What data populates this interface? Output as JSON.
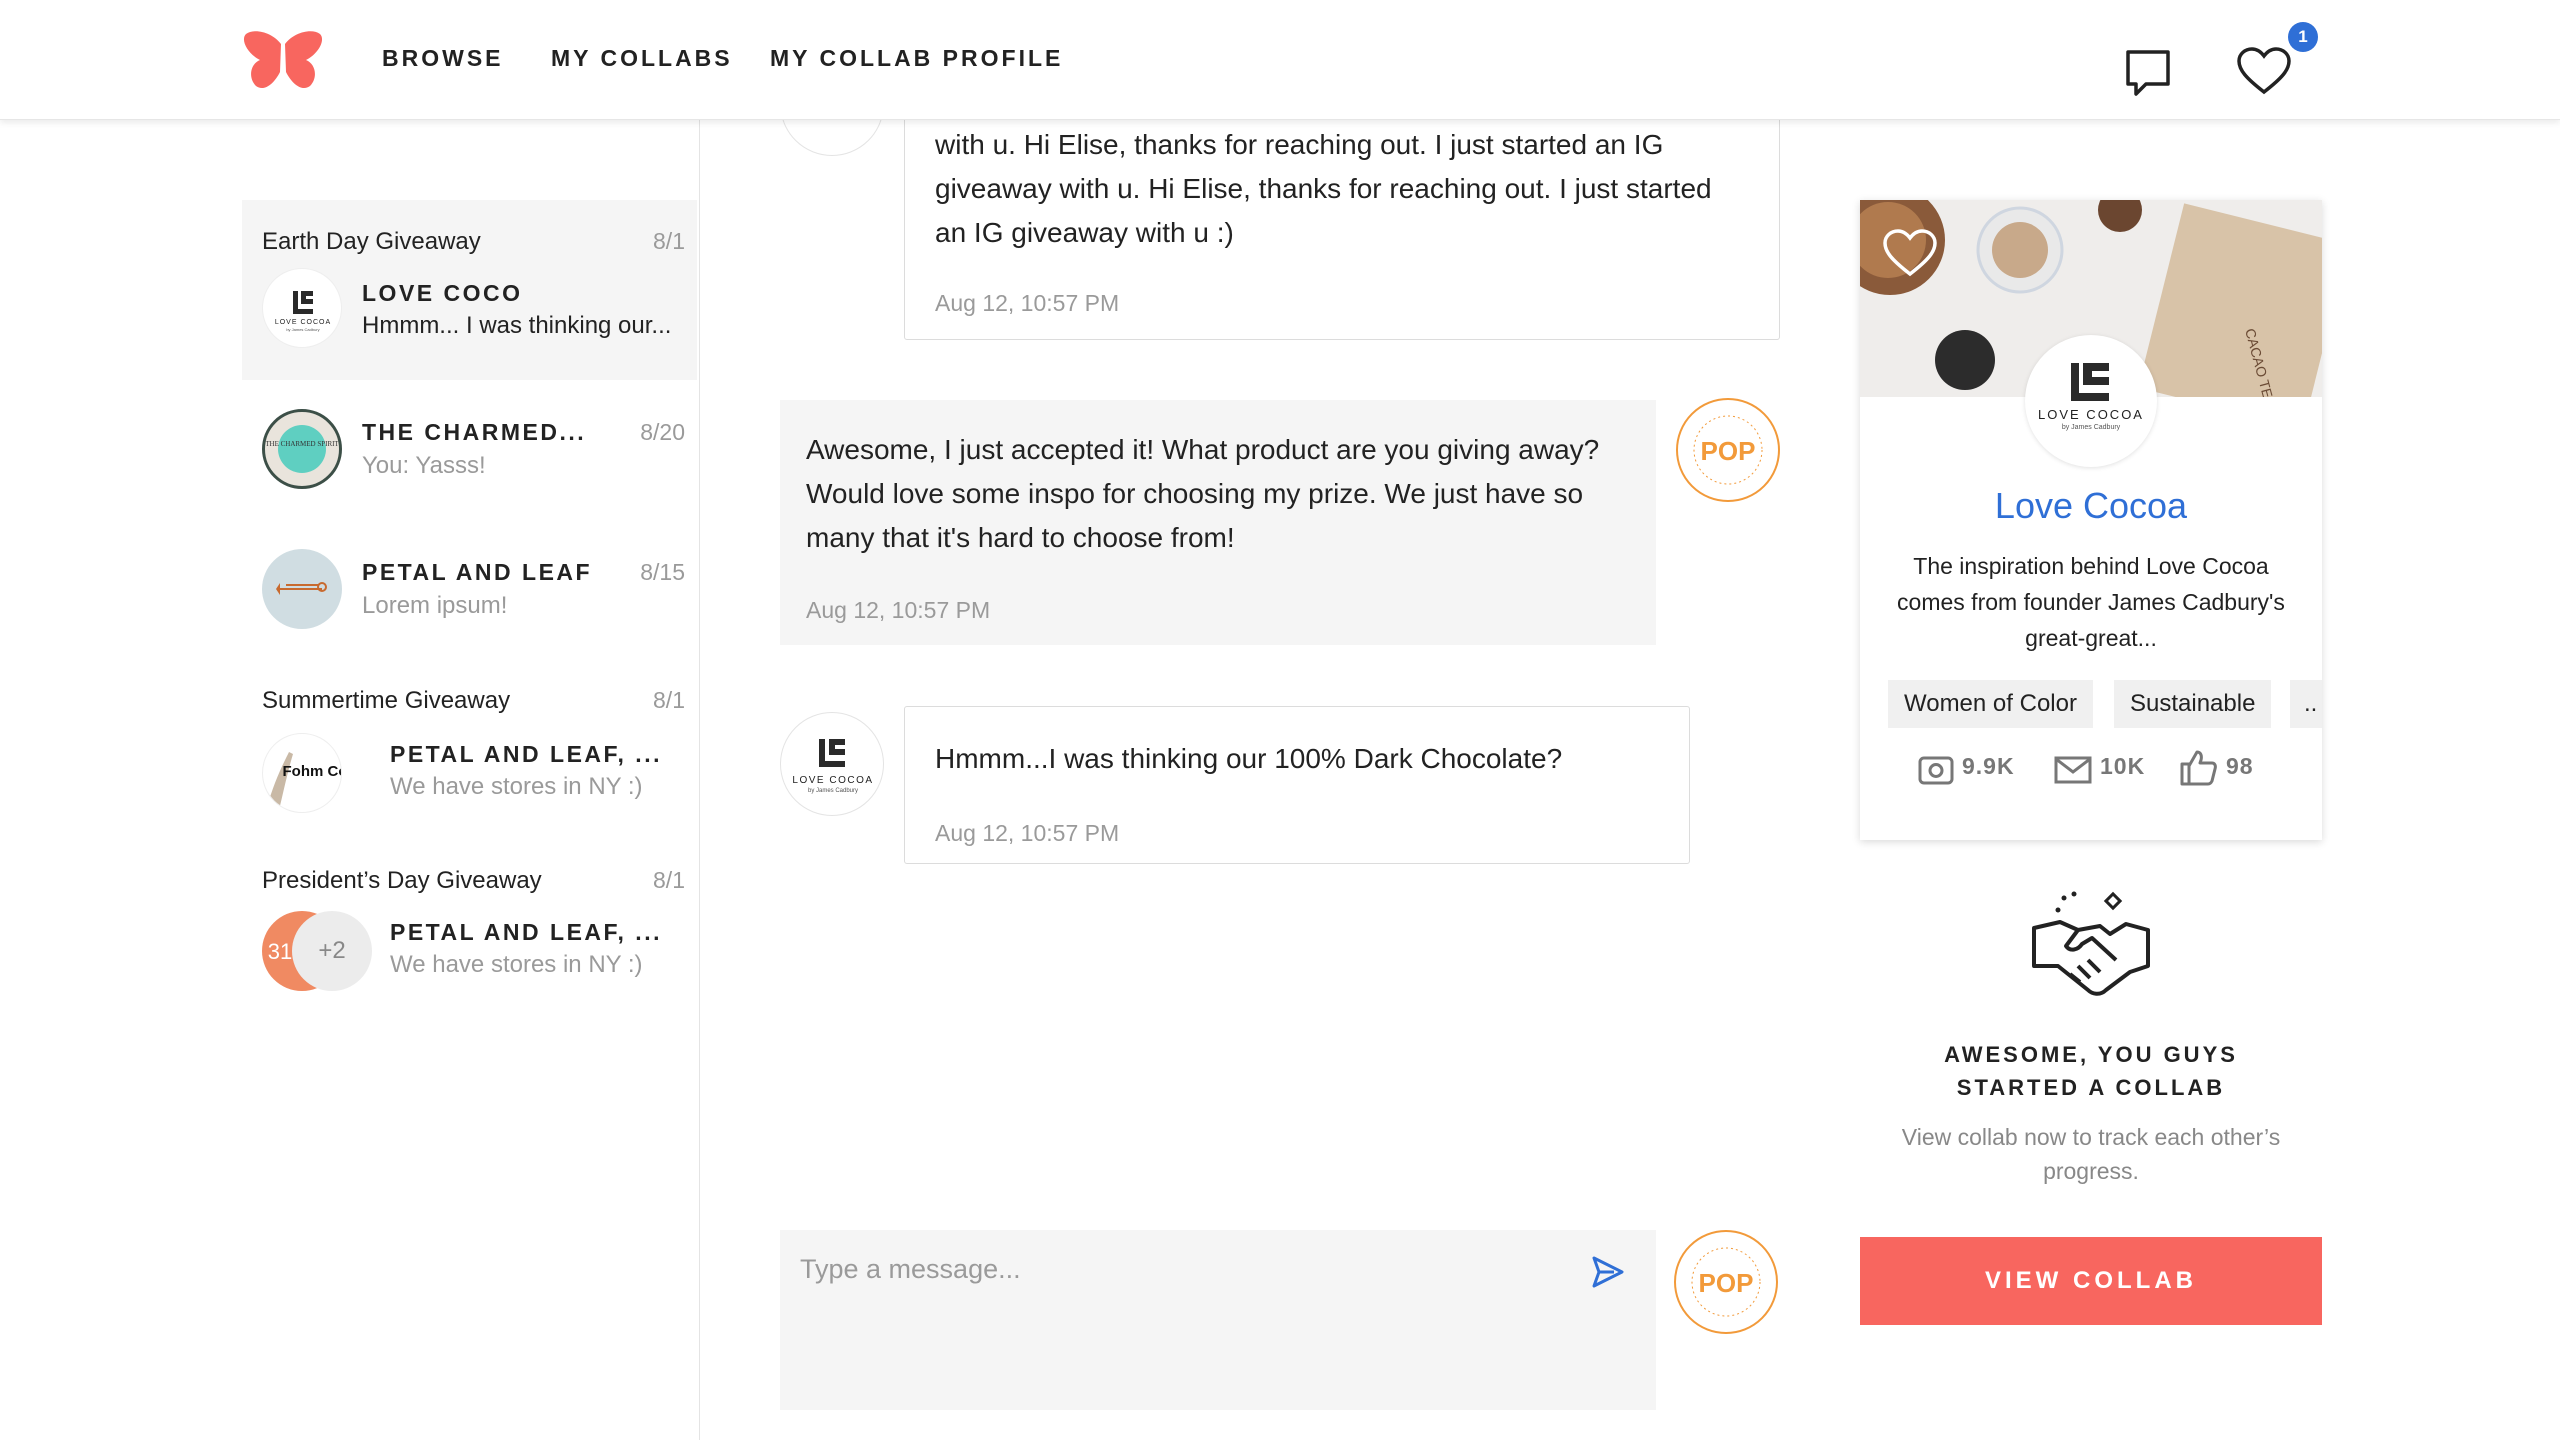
{
  "nav": {
    "links": [
      "BROWSE",
      "MY COLLABS",
      "MY COLLAB PROFILE"
    ],
    "notification_count": "1",
    "icons": [
      "butterfly-logo",
      "chat-icon",
      "heart-icon"
    ]
  },
  "conversations": [
    {
      "group": "Earth Day Giveaway",
      "date": "8/1",
      "name": "LOVE COCO",
      "preview": "Hmmm... I was thinking our...",
      "active": true
    },
    {
      "group": "",
      "date": "8/20",
      "name": "THE CHARMED...",
      "preview": "You: Yasss!",
      "avatar_text": "THE CHARMED SPIRIT"
    },
    {
      "group": "",
      "date": "8/15",
      "name": "PETAL AND LEAF",
      "preview": "Lorem ipsum!"
    },
    {
      "group": "Summertime Giveaway",
      "date": "8/1",
      "name": "PETAL AND LEAF, ...",
      "preview": "We have stores in NY :)",
      "avatar_text": "Fohm Co"
    },
    {
      "group": "President’s Day Giveaway",
      "date": "8/1",
      "name": "PETAL AND LEAF, ...",
      "preview": "We have stores in NY :)",
      "avatar_text": "31",
      "extra_count": "+2"
    }
  ],
  "messages": [
    {
      "from": "them",
      "text": "with u. Hi Elise, thanks for reaching out. I just started an IG giveaway with u. Hi Elise, thanks for reaching out. I just started an IG giveaway with u :)",
      "time": "Aug 12, 10:57 PM"
    },
    {
      "from": "me",
      "text": "Awesome, I just accepted it! What product are you giving away? Would love some inspo for choosing my prize. We just have so many that it's hard to choose from!",
      "time": "Aug 12, 10:57 PM"
    },
    {
      "from": "them",
      "text": "Hmmm...I was thinking our 100% Dark Chocolate?",
      "time": "Aug 12, 10:57 PM"
    }
  ],
  "composer": {
    "placeholder": "Type a message..."
  },
  "brands": {
    "love_cocoa_logo_line1": "LOVE COCOA",
    "love_cocoa_logo_line2": "by James Cadbury",
    "pop_logo": "POP"
  },
  "profile_card": {
    "name": "Love Cocoa",
    "description": "The inspiration behind Love Cocoa comes from founder James Cadbury's great-great...",
    "tags": [
      "Women of Color",
      "Sustainable",
      ".."
    ],
    "stats": {
      "instagram": "9.9K",
      "email": "10K",
      "facebook": "98"
    },
    "photo_text": "CACAO TEA"
  },
  "collab": {
    "title_line1": "AWESOME, YOU GUYS",
    "title_line2": "STARTED A COLLAB",
    "subtitle": "View collab now to track each other’s progress.",
    "button": "VIEW COLLAB"
  },
  "colors": {
    "accent_blue": "#2f6fd6",
    "brand_coral": "#f8665f",
    "pop_orange": "#f29a3a"
  }
}
